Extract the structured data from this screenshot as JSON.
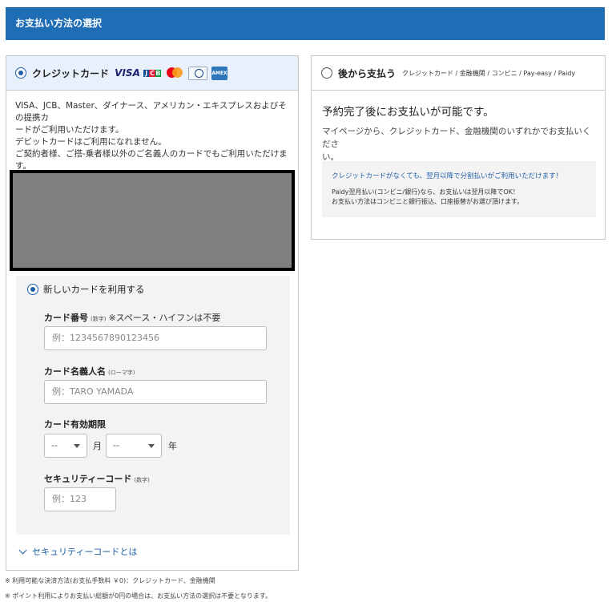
{
  "header": {
    "title": "お支払い方法の選択"
  },
  "credit": {
    "label": "クレジットカード",
    "brands": {
      "visa": "VISA",
      "jcb": [
        "J",
        "C",
        "B"
      ],
      "amex": "AMEX"
    },
    "desc": [
      "VISA、JCB、Master、ダイナース、アメリカン・エキスプレスおよびその提携カ",
      "ードがご利用いただけます。",
      "デビットカードはご利用になれません。",
      "ご契約者様、ご搭-乗者様以外のご名義人のカードでもご利用いただけま",
      "す。"
    ],
    "new_card_label": "新しいカードを利用する",
    "card_number": {
      "label": "カード番号",
      "sub": "(数字)",
      "note": "※スペース・ハイフンは不要",
      "placeholder": "例：1234567890123456"
    },
    "card_name": {
      "label": "カード名義人名",
      "sub": "(ローマ字)",
      "placeholder": "例：TARO YAMADA"
    },
    "expiry": {
      "label": "カード有効期限",
      "month_value": "--",
      "month_unit": "月",
      "year_value": "--",
      "year_unit": "年"
    },
    "security": {
      "label": "セキュリティーコード",
      "sub": "(数字)",
      "placeholder": "例：123"
    },
    "security_link": "セキュリティーコードとは"
  },
  "later": {
    "label": "後から支払う",
    "sub": "クレジットカード / 金融機関 / コンビニ / Pay-easy / Paidy",
    "title": "予約完了後にお支払いが可能です。",
    "desc": [
      "マイページから、クレジットカード、金融機関のいずれかでお支払いくださ",
      "い。"
    ],
    "info_strong": "クレジットカードがなくても、翌月以降で分割払いがご利用いただけます！",
    "info_text": [
      "Paidy翌月払い(コンビニ/銀行)なら、お支払いは翌月以降でOK！",
      "お支払い方法はコンビニと銀行振込、口座振替がお選び頂けます。"
    ]
  },
  "footnotes": [
    "※ 利用可能な決済方法(お支払手数料 ￥0)：クレジットカード、金融機関",
    "※ ポイント利用によりお支払い総額が0円の場合は、お支払い方法の選択は不要となります。"
  ]
}
